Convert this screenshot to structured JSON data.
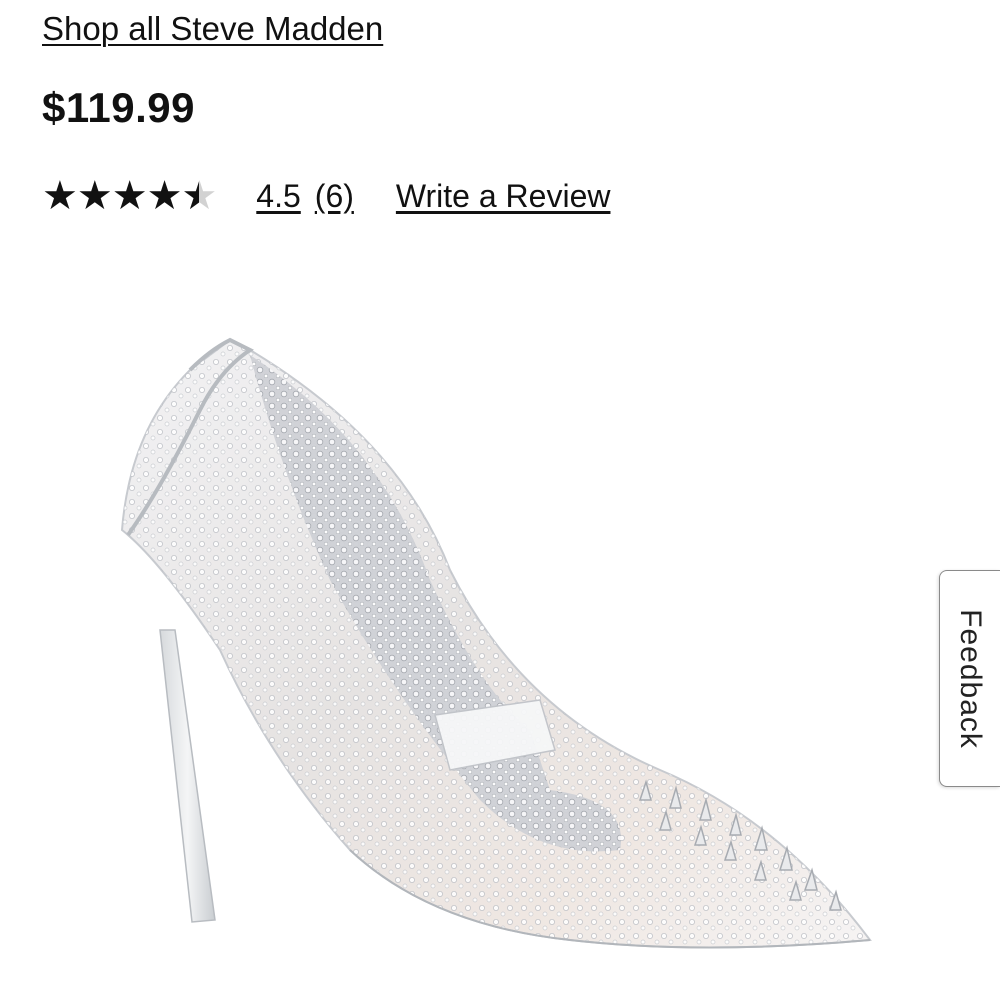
{
  "product": {
    "brand_link": "Shop all Steve Madden",
    "price": "$119.99",
    "rating": {
      "value": 4.5,
      "value_label": "4.5",
      "max": 5,
      "count_label": "(6)",
      "write_review_label": "Write a Review",
      "star_color": "#111111",
      "star_empty_color": "#d2d2d2"
    },
    "image_icon": "rhinestone-clear-pump-image"
  },
  "feedback_tab": {
    "label": "Feedback"
  }
}
